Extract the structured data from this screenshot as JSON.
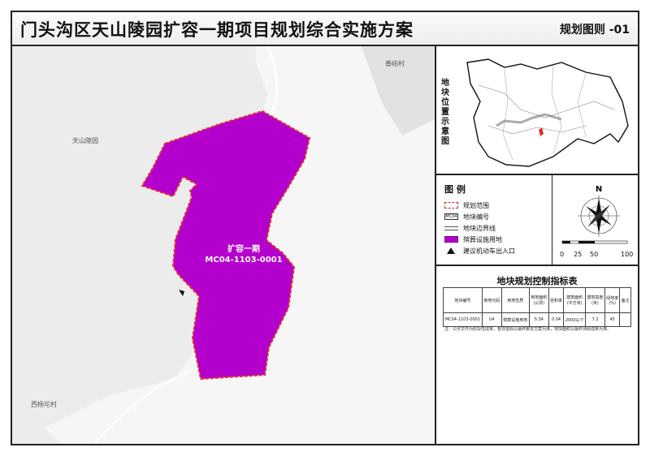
{
  "header": {
    "title": "门头沟区天山陵园扩容一期项目规划综合实施方案",
    "figure_no": "规划图则 -01"
  },
  "map": {
    "places": [
      {
        "name": "香峪村"
      },
      {
        "name": "天山陵园"
      },
      {
        "name": "西杨坨村"
      }
    ],
    "parcel": {
      "name": "扩容一期",
      "code": "MC04-1103-0001",
      "fill_color": "#b300cc",
      "boundary_color": "#e0302e"
    }
  },
  "location_panel": {
    "title_chars": [
      "地",
      "块",
      "位",
      "置",
      "示",
      "意",
      "图"
    ]
  },
  "legend": {
    "heading": "图  例",
    "code_symbol": "MC04",
    "items": [
      {
        "symbol": "boundary-dashed",
        "label": "规划范围"
      },
      {
        "symbol": "parcel-code",
        "label": "地块编号"
      },
      {
        "symbol": "parcel-line",
        "label": "地块边界线"
      },
      {
        "symbol": "purple-fill",
        "label": "殡葬设施用地"
      },
      {
        "symbol": "triangle",
        "label": "建议机动车出入口"
      }
    ],
    "north": "N",
    "scale_ticks": [
      "0",
      "25",
      "50",
      "100"
    ]
  },
  "control_table": {
    "title": "地块规划控制指标表",
    "headers": [
      "地块编号",
      "用地代码",
      "用地性质",
      "用地面积\n(公顷)",
      "容积率",
      "建筑面积\n(平方米)",
      "建筑高度\n(米)",
      "绿地率\n(%)",
      "备注"
    ],
    "rows": [
      [
        "MC04-1103-0001",
        "U4",
        "殡葬设施用地",
        "5.34",
        "0.04",
        "2000以下",
        "7.2",
        "45",
        ""
      ]
    ],
    "note": "注：公示文件为阶段性成果，各项指标以最终审定方案为准，地块面积以最终测绘成果为准。"
  }
}
